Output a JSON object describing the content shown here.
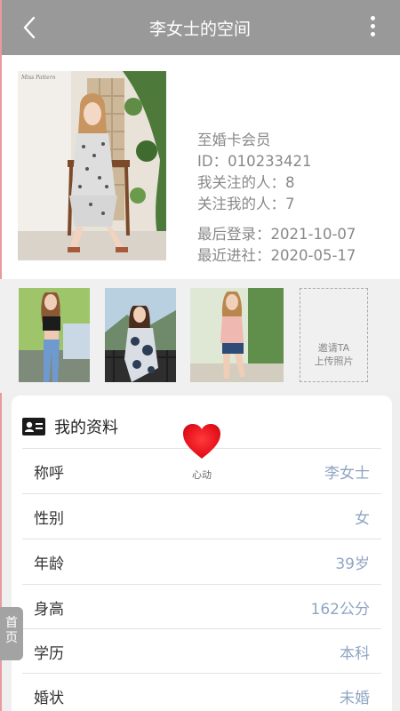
{
  "header": {
    "title": "李女士的空间",
    "back_icon": "chevron-left-icon",
    "more_icon": "more-vertical-icon"
  },
  "profile": {
    "photo_caption": "Miss Pattern",
    "membership": "至婚卡会员",
    "id_text": "ID：010233421",
    "following_text": "我关注的人：8",
    "followers_text": "关注我的人：7",
    "last_login_text": "最后登录：2021-10-07",
    "last_visit_text": "最近进社：2020-05-17"
  },
  "gallery": {
    "invite_line1": "邀请TA",
    "invite_line2": "上传照片"
  },
  "details": {
    "title": "我的资料",
    "icon": "id-card-icon",
    "rows": [
      {
        "label": "称呼",
        "value": "李女士"
      },
      {
        "label": "性别",
        "value": "女"
      },
      {
        "label": "年龄",
        "value": "39岁"
      },
      {
        "label": "身高",
        "value": "162公分"
      },
      {
        "label": "学历",
        "value": "本科"
      },
      {
        "label": "婚状",
        "value": "未婚"
      }
    ]
  },
  "heart": {
    "label": "心动",
    "color": "#e8141e"
  },
  "home_tab": {
    "line1": "首",
    "line2": "页"
  },
  "colors": {
    "topbar": "#999999",
    "value_text": "#8fa5c4",
    "info_text": "#888888"
  }
}
